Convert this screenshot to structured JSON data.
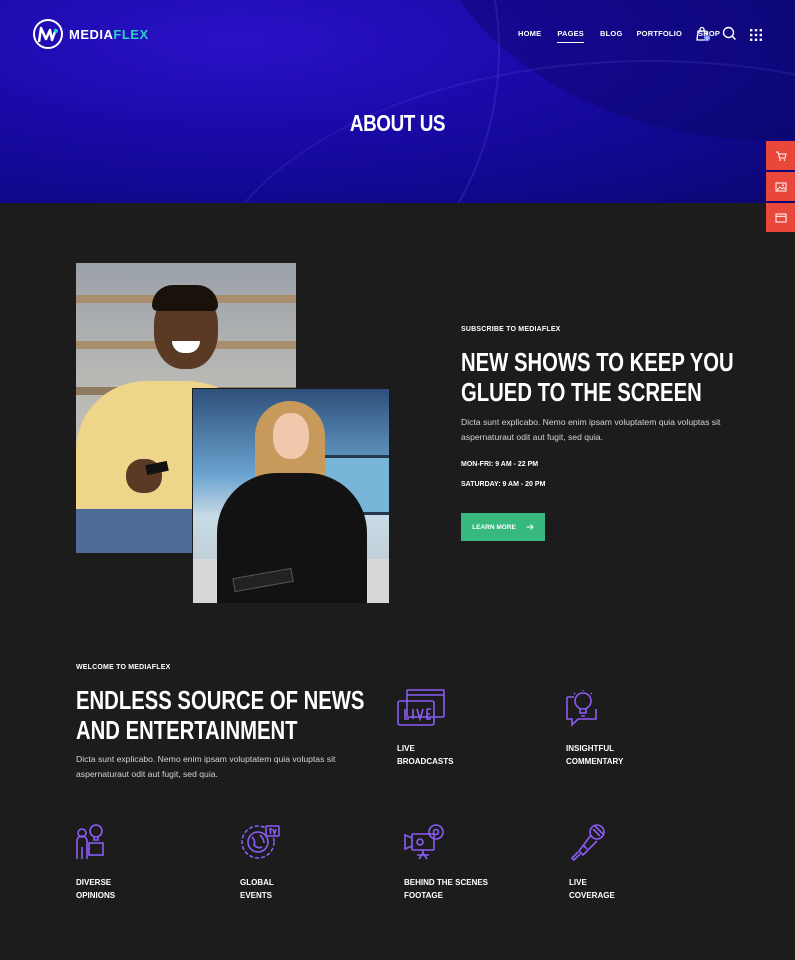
{
  "header": {
    "logo_text_a": "MEDIA",
    "logo_text_b": "FLEX",
    "nav": [
      "HOME",
      "PAGES",
      "BLOG",
      "PORTFOLIO",
      "SHOP"
    ],
    "active_nav": "PAGES",
    "cart_count": "0",
    "icons": [
      "shopping-bag-icon",
      "search-icon",
      "grid-menu-icon"
    ]
  },
  "hero": {
    "title": "ABOUT US"
  },
  "side_buttons": [
    "cart-icon",
    "image-icon",
    "browser-icon"
  ],
  "subscribe": {
    "kicker": "SUBSCRIBE TO MEDIAFLEX",
    "headline_line1": "NEW SHOWS TO KEEP YOU",
    "headline_line2": "GLUED TO THE SCREEN",
    "para_line1": "Dicta sunt explicabo. Nemo enim ipsam voluptatem quia voluptas sit",
    "para_line2": "aspernaturaut odit aut fugit, sed quia.",
    "hours1": "MON-FRI: 9 AM - 22 PM",
    "hours2": "SATURDAY: 9 AM - 20 PM",
    "button": "LEARN MORE"
  },
  "welcome": {
    "kicker": "WELCOME TO MEDIAFLEX",
    "headline_line1": "ENDLESS SOURCE OF NEWS",
    "headline_line2": "AND ENTERTAINMENT",
    "para_line1": "Dicta sunt explicabo. Nemo enim ipsam voluptatem quia voluptas sit",
    "para_line2": "aspernaturaut odit aut fugit, sed quia."
  },
  "features": [
    {
      "label": "LIVE\nBROADCASTS",
      "icon": "live-broadcast-icon"
    },
    {
      "label": "INSIGHTFUL\nCOMMENTARY",
      "icon": "idea-chat-icon"
    },
    {
      "label": "DIVERSE\nOPINIONS",
      "icon": "speaker-idea-icon"
    },
    {
      "label": "GLOBAL\nEVENTS",
      "icon": "global-tv-icon"
    },
    {
      "label": "BEHIND THE SCENES\nFOOTAGE",
      "icon": "camera-icon"
    },
    {
      "label": "LIVE\nCOVERAGE",
      "icon": "microphone-icon"
    }
  ],
  "colors": {
    "hero_blue": "#1a0aa8",
    "accent_teal": "#27d3c0",
    "button_green": "#36b87e",
    "side_red": "#e9473a",
    "icon_purple": "#8b5cf6",
    "background": "#1c1c1c"
  }
}
